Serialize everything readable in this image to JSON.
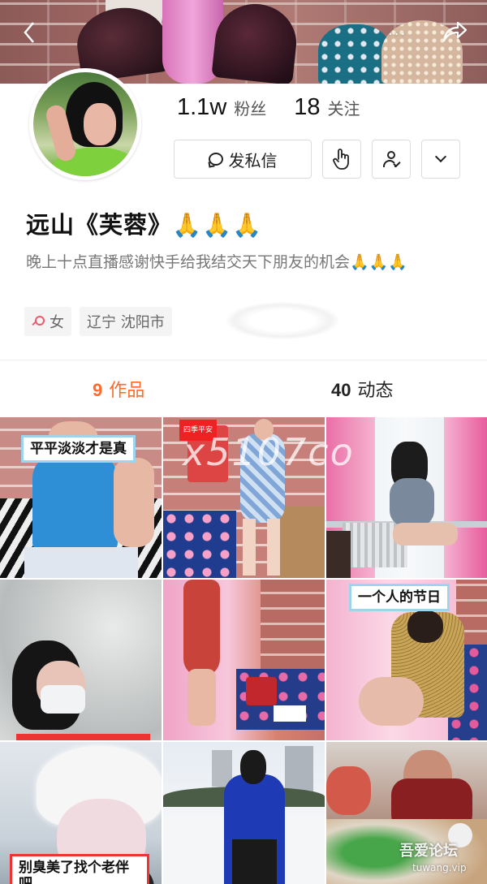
{
  "header": {
    "back_icon": "back-chevron-icon",
    "more_label": "···",
    "share_icon": "share-arrow-icon"
  },
  "profile": {
    "followers_count": "1.1w",
    "followers_label": "粉丝",
    "following_count": "18",
    "following_label": "关注",
    "message_button_label": "发私信",
    "name": "远山《芙蓉》🙏🙏🙏",
    "bio": "晚上十点直播感谢快手给我结交天下朋友的机会🙏🙏🙏",
    "gender": "女",
    "location": "辽宁 沈阳市"
  },
  "tabs": [
    {
      "count": "9",
      "label": "作品",
      "active": true
    },
    {
      "count": "40",
      "label": "动态",
      "active": false
    }
  ],
  "grid": [
    {
      "caption": "平平淡淡才是真"
    },
    {
      "caption": "四季平安"
    },
    {
      "caption": ""
    },
    {
      "caption": ""
    },
    {
      "caption": ""
    },
    {
      "caption": "一个人的节日"
    },
    {
      "caption": "别臭美了找个老伴吧"
    },
    {
      "caption": ""
    },
    {
      "caption": ""
    }
  ],
  "watermarks": {
    "overlay": "x5107co",
    "forum_title": "吾爱论坛",
    "forum_url": "tuwang.vip"
  },
  "colors": {
    "accent": "#ff6a2c",
    "tag_bg": "#f4f4f4",
    "caption_border": "#9fd4ef"
  }
}
